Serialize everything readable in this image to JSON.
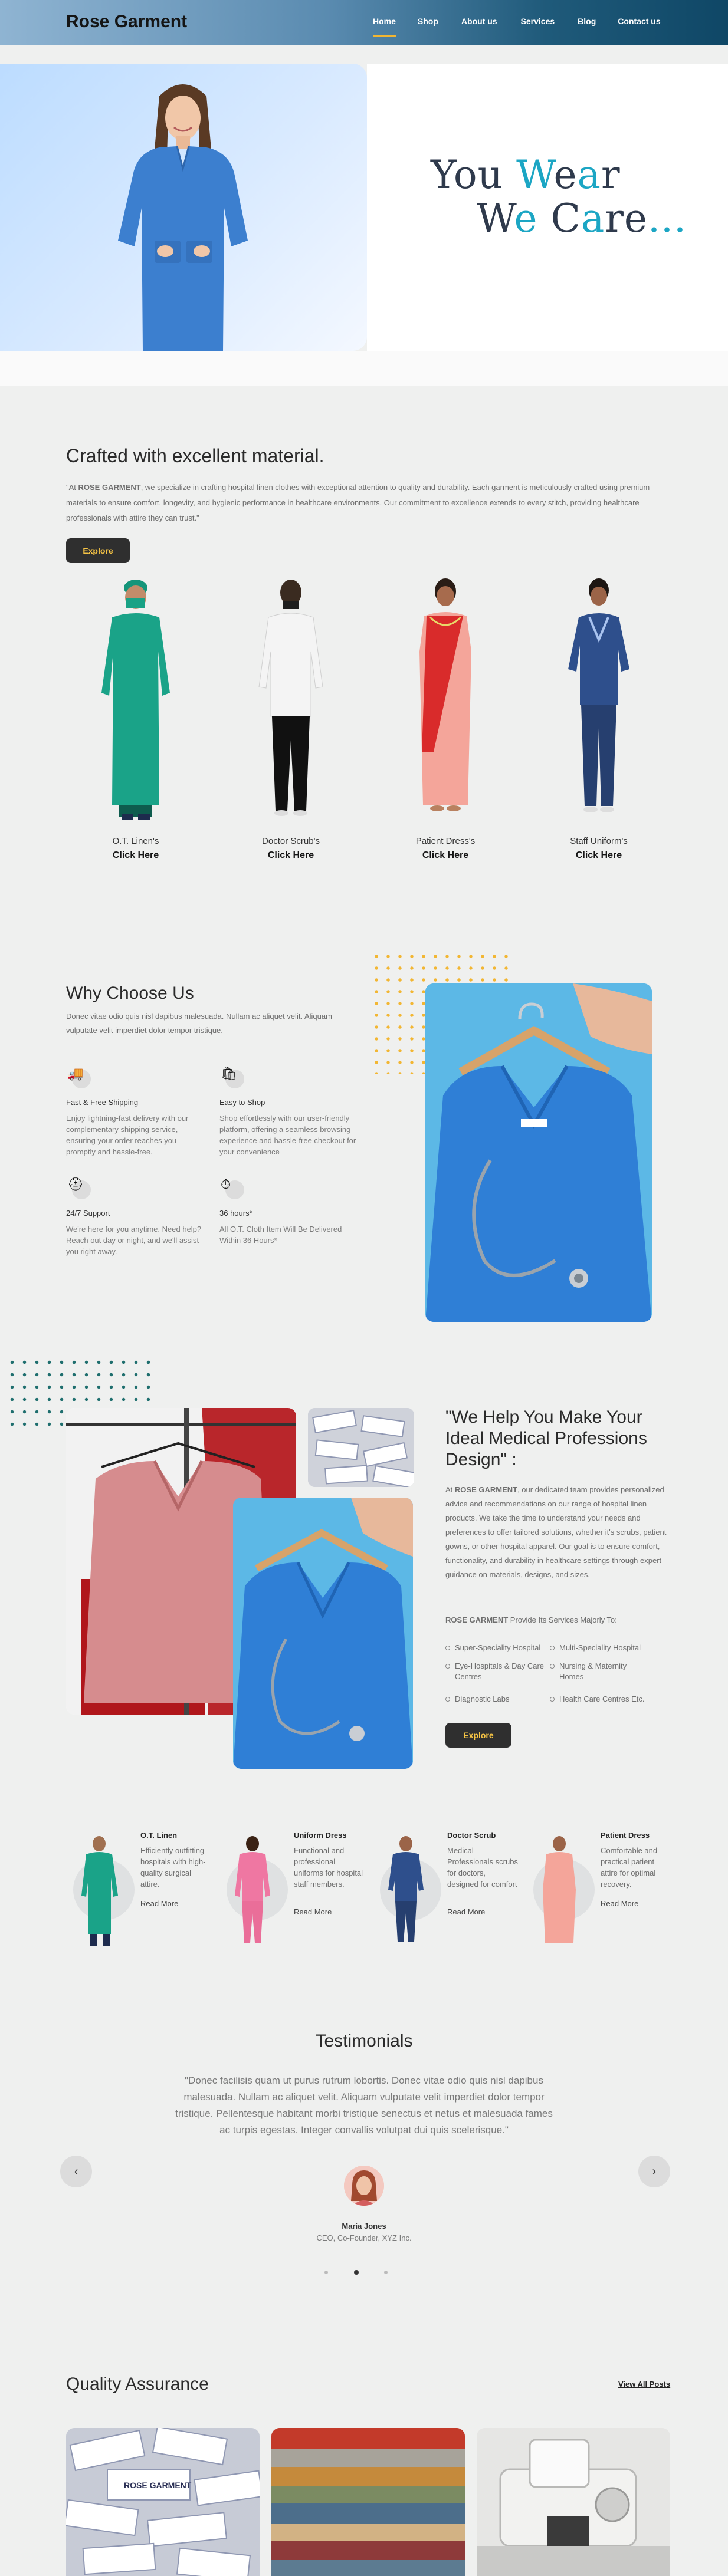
{
  "header": {
    "brand": "Rose Garment",
    "nav": [
      "Home",
      "Shop",
      "About us",
      "Services",
      "Blog",
      "Contact us"
    ],
    "active_nav": "Home",
    "accent_color": "#f2b632"
  },
  "hero": {
    "line1_a": "You ",
    "line1_b": "W",
    "line1_c": "e",
    "line1_d": "a",
    "line1_e": "r",
    "line2_a": "W",
    "line2_b": "e",
    "line2_c": " C",
    "line2_d": "a",
    "line2_e": "re",
    "line2_f": "...",
    "accent_color": "#1ca6c4"
  },
  "crafted": {
    "title": "Crafted with excellent material.",
    "desc_prefix": "\"At ",
    "desc_brand": "ROSE GARMENT",
    "desc_rest": ", we specialize in crafting hospital linen clothes with exceptional attention to quality and durability. Each garment is meticulously crafted using premium materials to ensure comfort, longevity, and hygienic performance in healthcare environments. Our commitment to excellence extends to every stitch, providing healthcare professionals with attire they can trust.\"",
    "button": "Explore",
    "products": [
      {
        "name": "O.T. Linen's",
        "link": "Click Here"
      },
      {
        "name": "Doctor Scrub's",
        "link": "Click Here"
      },
      {
        "name": "Patient Dress's",
        "link": "Click Here"
      },
      {
        "name": "Staff Uniform's",
        "link": "Click Here"
      }
    ]
  },
  "why": {
    "title": "Why Choose Us",
    "desc": "Donec vitae odio quis nisl dapibus malesuada. Nullam ac aliquet velit. Aliquam vulputate velit imperdiet dolor tempor tristique.",
    "features": [
      {
        "icon": "truck-icon",
        "glyph": "🚚",
        "title": "Fast & Free Shipping",
        "desc": "Enjoy lightning-fast delivery with our complementary shipping service, ensuring your order reaches you promptly and hassle-free."
      },
      {
        "icon": "shopping-bag-icon",
        "glyph": "🛍",
        "title": "Easy to Shop",
        "desc": "Shop effortlessly with our user-friendly platform, offering a seamless browsing experience and hassle-free checkout for your convenience"
      },
      {
        "icon": "support-icon",
        "glyph": "⛑",
        "title": "24/7 Support",
        "desc": "We're here for you anytime. Need help? Reach out day or night, and we'll assist you right away."
      },
      {
        "icon": "stopwatch-icon",
        "glyph": "⏱",
        "title": "36 hours*",
        "desc": "All O.T. Cloth Item Will Be Delivered Within 36 Hours*"
      }
    ]
  },
  "help": {
    "title": "\"We Help You Make Your Ideal Medical Professions Design\" :",
    "desc_prefix": "At ",
    "desc_brand": "ROSE GARMENT",
    "desc_rest": ", our dedicated team provides personalized advice and recommendations on our range of hospital linen products. We take the time to understand your needs and preferences to offer tailored solutions, whether it's scrubs, patient gowns, or other hospital apparel. Our goal is to ensure comfort, functionality, and durability in healthcare settings through expert guidance on materials, designs, and sizes.",
    "sub_brand": "ROSE GARMENT",
    "sub_rest": " Provide Its Services Majorly To:",
    "services": [
      "Super-Speciality Hospital",
      "Multi-Speciality Hospital",
      "Eye-Hospitals & Day Care Centres",
      "Nursing & Maternity Homes",
      "Diagnostic Labs",
      "Health Care Centres Etc."
    ],
    "button": "Explore"
  },
  "categories": [
    {
      "title": "O.T. Linen",
      "desc": "Efficiently outfitting hospitals with high-quality surgical attire.",
      "more": "Read More"
    },
    {
      "title": "Uniform Dress",
      "desc": "Functional and professional uniforms for hospital staff members.",
      "more": "Read More"
    },
    {
      "title": "Doctor Scrub",
      "desc": "Medical Professionals scrubs for doctors, designed for comfort",
      "more": "Read More"
    },
    {
      "title": "Patient Dress",
      "desc": "Comfortable and practical patient attire for optimal recovery.",
      "more": "Read More"
    }
  ],
  "testimonials": {
    "title": "Testimonials",
    "quote": "\"Donec facilisis quam ut purus rutrum lobortis. Donec vitae odio quis nisl dapibus malesuada. Nullam ac aliquet velit. Aliquam vulputate velit imperdiet dolor tempor tristique. Pellentesque habitant morbi tristique senectus et netus et malesuada fames ac turpis egestas. Integer convallis volutpat dui quis scelerisque.\"",
    "prev": "‹",
    "next": "›",
    "name": "Maria Jones",
    "role": "CEO, Co-Founder, XYZ Inc.",
    "pages": 3,
    "active_page": 2
  },
  "quality": {
    "title": "Quality Assurance",
    "link": "View All Posts",
    "label_text": "ROSE GARMENT"
  }
}
